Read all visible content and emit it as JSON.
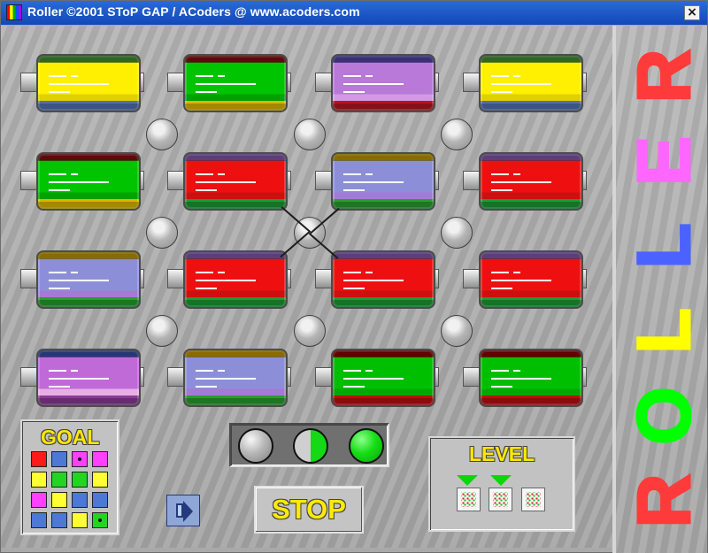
{
  "window": {
    "title": "Roller ©2001 SToP GAP / ACoders @ www.acoders.com",
    "close_glyph": "×"
  },
  "board": {
    "rollers": [
      [
        "yellow",
        "green",
        "violet",
        "yellow"
      ],
      [
        "green",
        "red",
        "blue",
        "red"
      ],
      [
        "blue",
        "red",
        "red",
        "red"
      ],
      [
        "pinkblue",
        "blue",
        "greenred",
        "greenred"
      ]
    ]
  },
  "goal": {
    "label": "GOAL",
    "colors": [
      [
        "#ff1a1a",
        "#4d78d6",
        "#ff40ff",
        "#ff40ff"
      ],
      [
        "#ffff33",
        "#24d424",
        "#24d424",
        "#ffff33"
      ],
      [
        "#ff40ff",
        "#ffff33",
        "#4d78d6",
        "#4d78d6"
      ],
      [
        "#4d78d6",
        "#4d78d6",
        "#ffff33",
        "#24d424"
      ]
    ],
    "marked_cells": [
      [
        0,
        2
      ],
      [
        3,
        3
      ]
    ]
  },
  "controls": {
    "stop_label": "STOP",
    "sound_icon": "speaker-icon"
  },
  "lamps": [
    "off",
    "half",
    "on"
  ],
  "level": {
    "label": "LEVEL",
    "buttons": 3,
    "active_markers": [
      0,
      1
    ]
  },
  "logo": {
    "letters": [
      "R",
      "E",
      "L",
      "L",
      "O",
      "R"
    ],
    "colors": [
      "#ff3a3a",
      "#ff66ff",
      "#4b62ff",
      "#ffff00",
      "#00ff00",
      "#ff3a3a"
    ]
  },
  "theme": {
    "title_blue": "#1f57c9",
    "text_yellow": "#ffe800"
  }
}
